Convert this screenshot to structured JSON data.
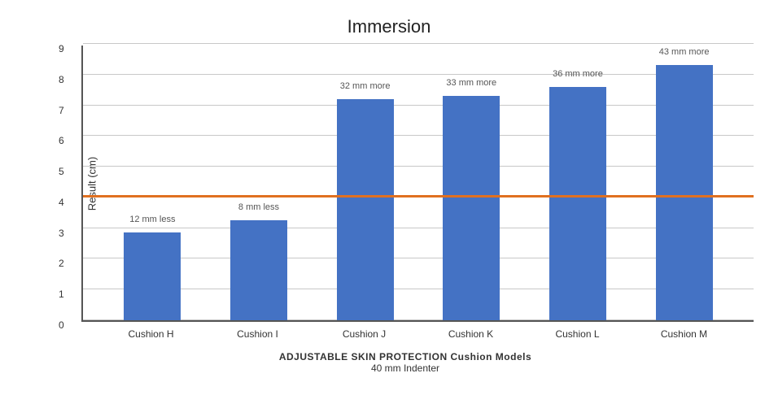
{
  "chart": {
    "title": "Immersion",
    "y_axis_label": "Result (cm)",
    "x_axis_subtitle1": "ADJUSTABLE SKIN PROTECTION Cushion Models",
    "x_axis_subtitle2": "40 mm Indenter",
    "ref_line_value": 4.0,
    "y_max": 9,
    "y_ticks": [
      0,
      1,
      2,
      3,
      4,
      5,
      6,
      7,
      8,
      9
    ],
    "bars": [
      {
        "label": "Cushion H",
        "value": 2.85,
        "annotation": "12 mm less",
        "annotation_pos": "above_bar"
      },
      {
        "label": "Cushion I",
        "value": 3.25,
        "annotation": "8 mm less",
        "annotation_pos": "above_bar"
      },
      {
        "label": "Cushion J",
        "value": 7.2,
        "annotation": "32  mm more",
        "annotation_pos": "top"
      },
      {
        "label": "Cushion K",
        "value": 7.3,
        "annotation": "33  mm more",
        "annotation_pos": "top"
      },
      {
        "label": "Cushion L",
        "value": 7.6,
        "annotation": "36  mm more",
        "annotation_pos": "top"
      },
      {
        "label": "Cushion M",
        "value": 8.3,
        "annotation": "43  mm more",
        "annotation_pos": "top"
      }
    ]
  }
}
